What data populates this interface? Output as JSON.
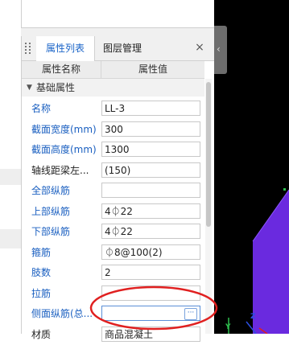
{
  "tabs": {
    "property_list": "属性列表",
    "layer_manager": "图层管理"
  },
  "close_label": "×",
  "columns": {
    "name": "属性名称",
    "value": "属性值"
  },
  "group": {
    "label": "基础属性"
  },
  "rows": [
    {
      "name": "名称",
      "value": "LL-3"
    },
    {
      "name": "截面宽度(mm)",
      "value": "300"
    },
    {
      "name": "截面高度(mm)",
      "value": "1300"
    },
    {
      "name": "轴线距梁左...",
      "value": "(150)"
    },
    {
      "name": "全部纵筋",
      "value": ""
    },
    {
      "name": "上部纵筋",
      "value": "4⏀22"
    },
    {
      "name": "下部纵筋",
      "value": "4⏀22"
    },
    {
      "name": "箍筋",
      "value": "⏀8@100(2)"
    },
    {
      "name": "肢数",
      "value": "2"
    },
    {
      "name": "拉筋",
      "value": ""
    },
    {
      "name": "侧面纵筋(总...",
      "value": ""
    },
    {
      "name": "材质",
      "value": "商品混凝土"
    }
  ],
  "ellipsis_label": "···",
  "collapse_arrow": "‹",
  "axis": {
    "x": "Z",
    "y": "Y"
  },
  "colors": {
    "accent": "#1a64c8",
    "annotation": "#e02020",
    "viewport_bg": "#000000",
    "model_purple": "#6a2adf"
  },
  "icons": [
    "drag-grip-icon",
    "close-icon",
    "collapse-arrow-icon",
    "expand-triangle-icon",
    "ellipsis-icon"
  ]
}
